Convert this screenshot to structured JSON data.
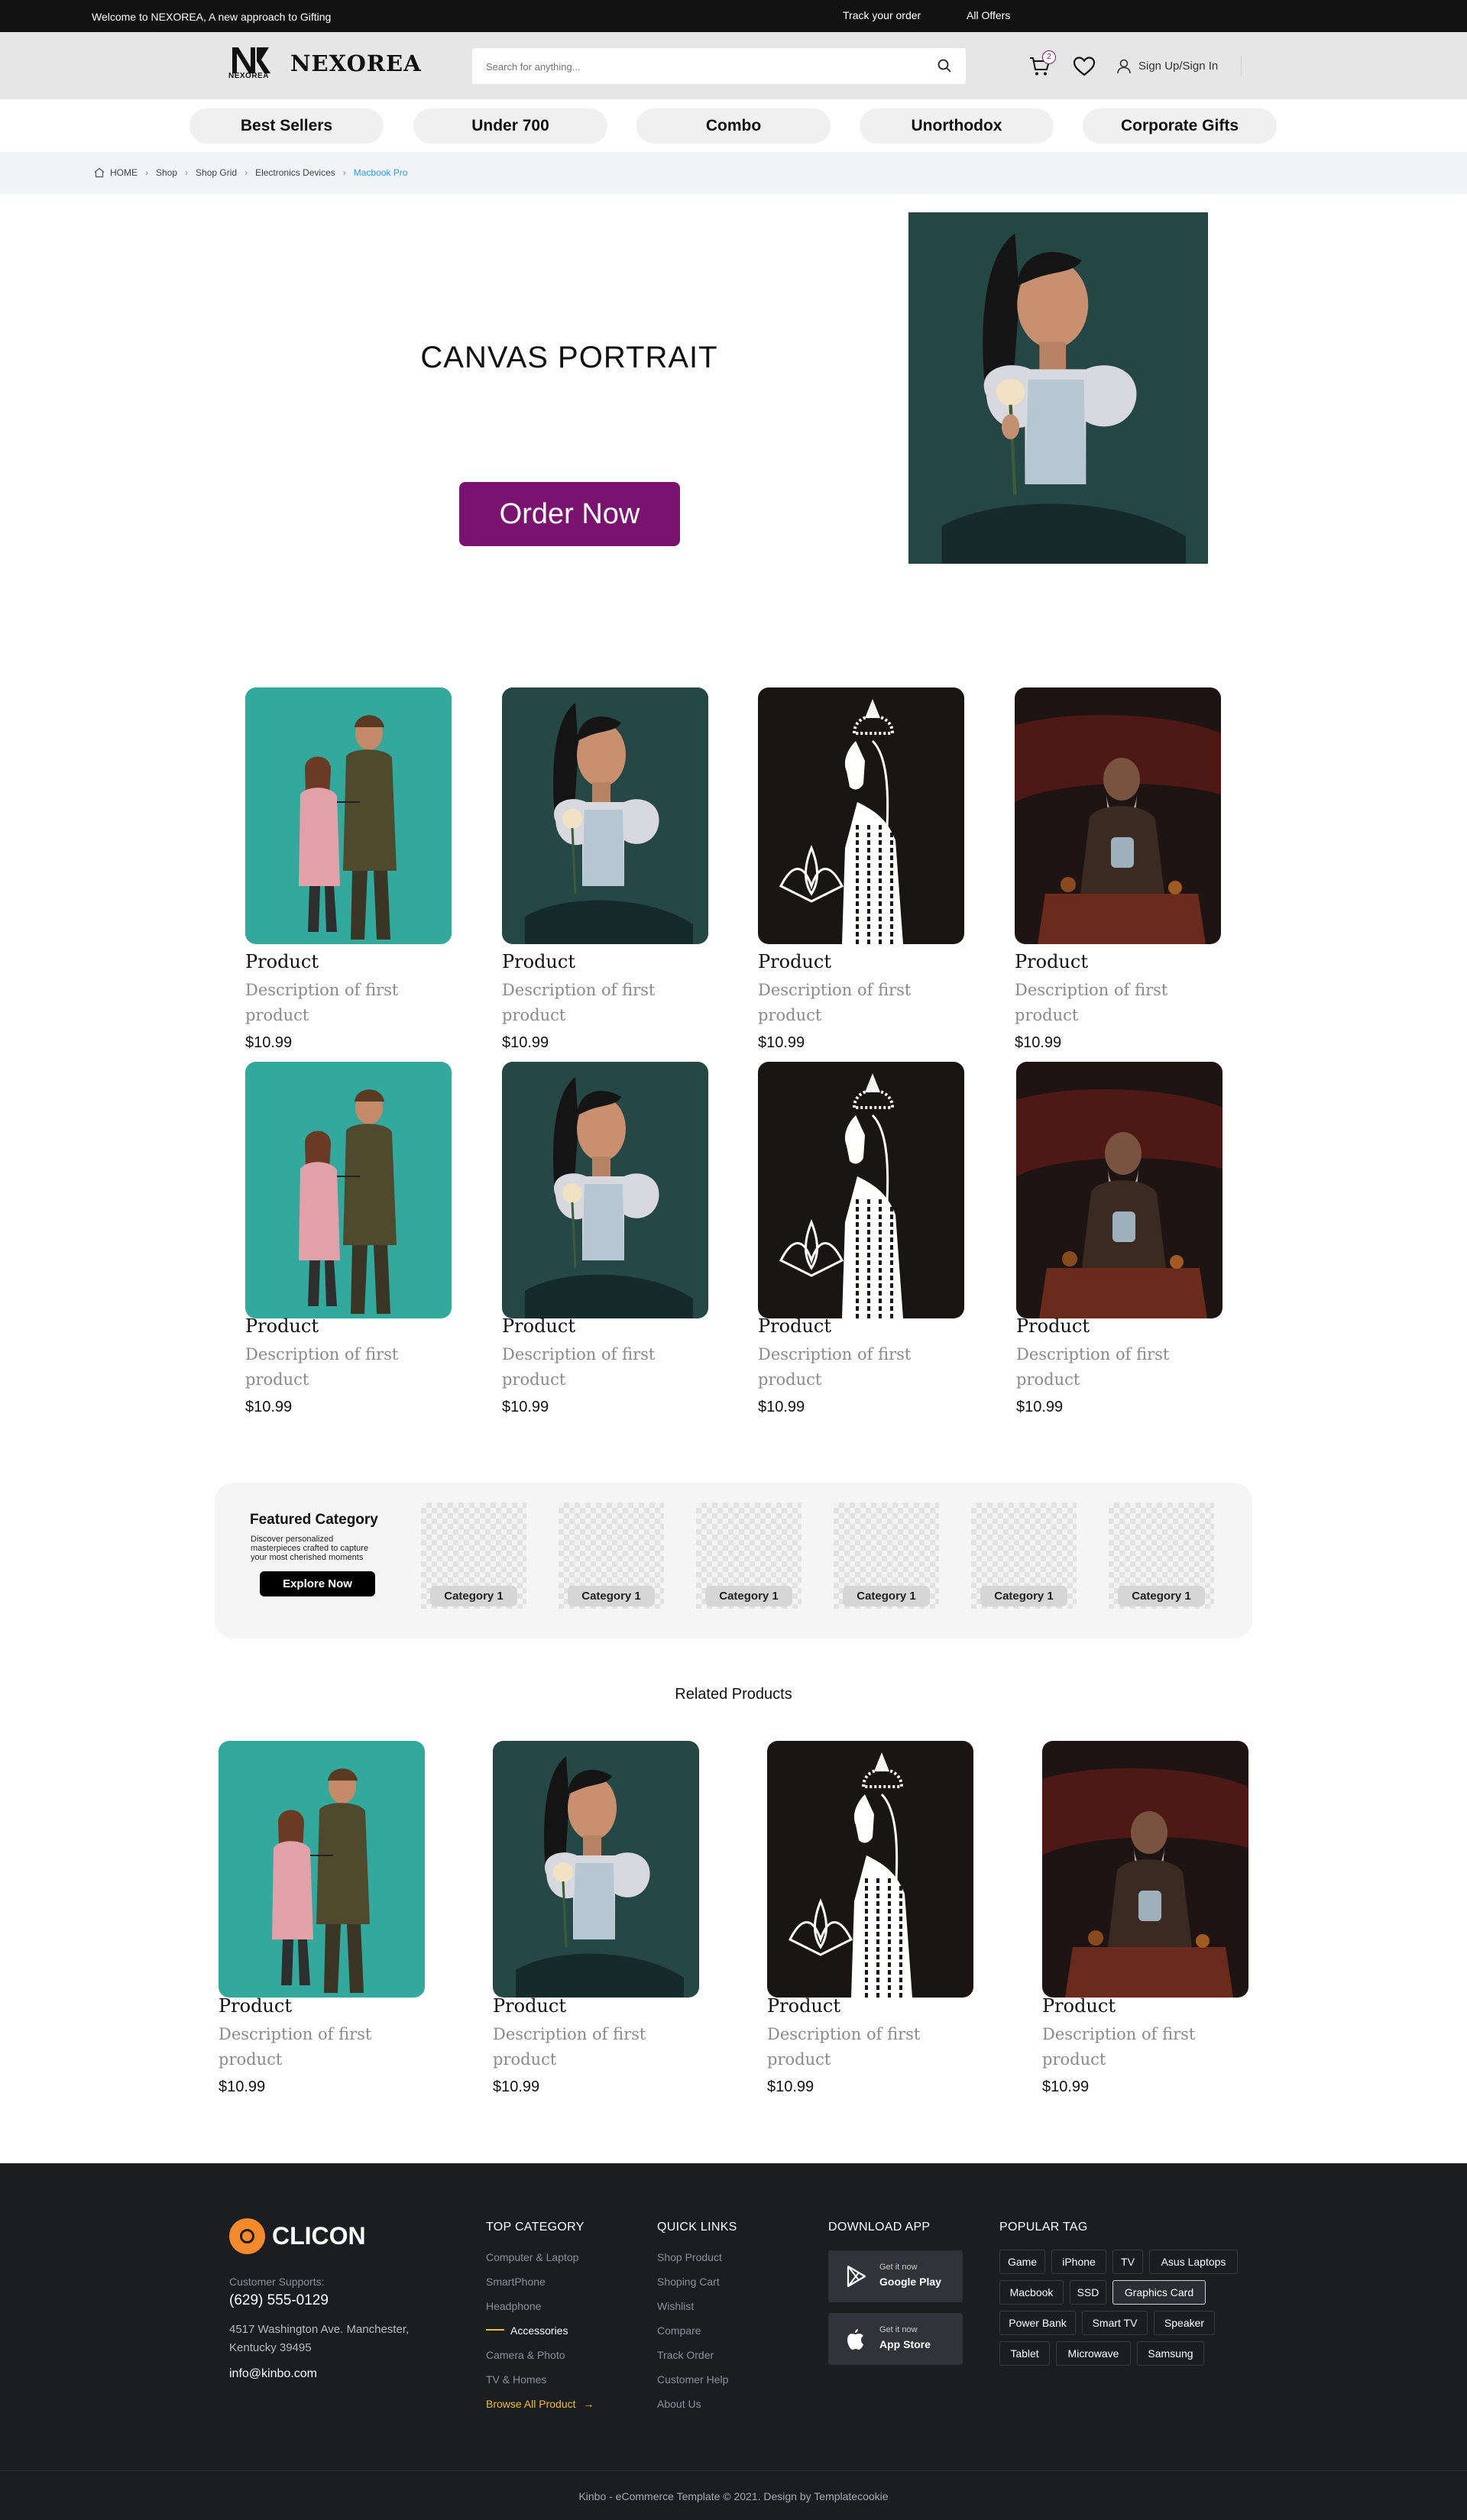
{
  "topbar": {
    "welcome": "Welcome to NEXOREA, A new approach to Gifting",
    "track": "Track your order",
    "offers": "All Offers"
  },
  "header": {
    "logo_sub": "NEXOREA",
    "logo_word": "NEXOREA",
    "search_placeholder": "Search for anything...",
    "cart_count": "2",
    "signin": "Sign Up/Sign In"
  },
  "nav": {
    "items": [
      "Best Sellers",
      "Under 700",
      "Combo",
      "Unorthodox",
      "Corporate Gifts"
    ]
  },
  "breadcrumb": {
    "items": [
      "HOME",
      "Shop",
      "Shop Grid",
      "Electronics Devices",
      "Macbook Pro"
    ]
  },
  "hero": {
    "title": "CANVAS PORTRAIT",
    "cta": "Order Now"
  },
  "products": [
    {
      "title": "Product",
      "desc": "Description of first product",
      "price": "$10.99",
      "art": "couple"
    },
    {
      "title": "Product",
      "desc": "Description of first product",
      "price": "$10.99",
      "art": "girl"
    },
    {
      "title": "Product",
      "desc": "Description of first product",
      "price": "$10.99",
      "art": "goddess"
    },
    {
      "title": "Product",
      "desc": "Description of first product",
      "price": "$10.99",
      "art": "sage"
    },
    {
      "title": "Product",
      "desc": "Description of first product",
      "price": "$10.99",
      "art": "couple"
    },
    {
      "title": "Product",
      "desc": "Description of first product",
      "price": "$10.99",
      "art": "girl"
    },
    {
      "title": "Product",
      "desc": "Description of first product",
      "price": "$10.99",
      "art": "goddess"
    },
    {
      "title": "Product",
      "desc": "Description of first product",
      "price": "$10.99",
      "art": "sage"
    }
  ],
  "featured": {
    "title": "Featured Category",
    "desc": "Discover personalized masterpieces crafted to capture your most cherished moments",
    "cta": "Explore Now",
    "categories": [
      "Category 1",
      "Category 1",
      "Category 1",
      "Category 1",
      "Category 1",
      "Category 1"
    ]
  },
  "related": {
    "title": "Related Products",
    "items": [
      {
        "title": "Product",
        "desc": "Description of first product",
        "price": "$10.99",
        "art": "couple"
      },
      {
        "title": "Product",
        "desc": "Description of first product",
        "price": "$10.99",
        "art": "girl"
      },
      {
        "title": "Product",
        "desc": "Description of first product",
        "price": "$10.99",
        "art": "goddess"
      },
      {
        "title": "Product",
        "desc": "Description of first product",
        "price": "$10.99",
        "art": "sage"
      }
    ]
  },
  "footer": {
    "brand": "CLICON",
    "support_label": "Customer Supports:",
    "phone": "(629) 555-0129",
    "address": "4517 Washington Ave. Manchester, Kentucky 39495",
    "email": "info@kinbo.com",
    "top_category": {
      "heading": "TOP CATEGORY",
      "links": [
        "Computer & Laptop",
        "SmartPhone",
        "Headphone",
        "Accessories",
        "Camera & Photo",
        "TV & Homes"
      ],
      "browse": "Browse All Product"
    },
    "quick_links": {
      "heading": "QUICK LINKS",
      "links": [
        "Shop Product",
        "Shoping Cart",
        "Wishlist",
        "Compare",
        "Track Order",
        "Customer Help",
        "About Us"
      ]
    },
    "download": {
      "heading": "DOWNLOAD APP",
      "google_small": "Get it now",
      "google_big": "Google Play",
      "apple_small": "Get it now",
      "apple_big": "App Store"
    },
    "tags": {
      "heading": "POPULAR TAG",
      "items": [
        "Game",
        "iPhone",
        "TV",
        "Asus Laptops",
        "Macbook",
        "SSD",
        "Graphics Card",
        "Power Bank",
        "Smart TV",
        "Speaker",
        "Tablet",
        "Microwave",
        "Samsung"
      ],
      "active": "Graphics Card"
    },
    "copyright": "Kinbo - eCommerce Template © 2021. Design by Templatecookie"
  },
  "colors": {
    "primary_cta": "#7a1270",
    "footer_bg": "#1b1d21",
    "accent": "#f3be2c",
    "brand_orange": "#f58a2c",
    "link_blue": "#2a9cf0"
  }
}
